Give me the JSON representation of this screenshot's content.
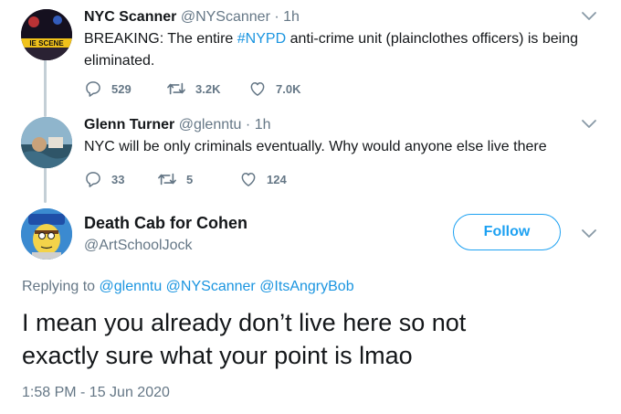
{
  "tweets": [
    {
      "name": "NYC Scanner",
      "handle": "@NYScanner",
      "time": "1h",
      "text_before": "BREAKING: The entire ",
      "hashtag": "#NYPD",
      "text_line1_after": " anti-crime unit (plainclothes officers) is being",
      "text_line2": "eliminated.",
      "avatar_text": "IE SCENE",
      "replies": "529",
      "retweets": "3.2K",
      "likes": "7.0K"
    },
    {
      "name": "Glenn Turner",
      "handle": "@glenntu",
      "time": "1h",
      "text": "NYC will be only criminals eventually. Why would anyone else live there",
      "replies": "33",
      "retweets": "5",
      "likes": "124"
    }
  ],
  "separator": "·",
  "focus": {
    "name": "Death Cab for Cohen",
    "handle": "@ArtSchoolJock",
    "follow_label": "Follow",
    "replying_prefix": "Replying to ",
    "replying_to": "@glenntu @NYScanner @ItsAngryBob",
    "text_line1": "I mean you already don’t live here so not",
    "text_line2": "exactly sure what your point is lmao",
    "timestamp": "1:58 PM - 15 Jun 2020"
  },
  "colors": {
    "link": "#1b95e0",
    "follow_border": "#1da1f2",
    "meta": "#657786",
    "thread_line": "#c4cfd6"
  },
  "icons": [
    "reply-icon",
    "retweet-icon",
    "like-icon",
    "chevron-down-icon"
  ]
}
